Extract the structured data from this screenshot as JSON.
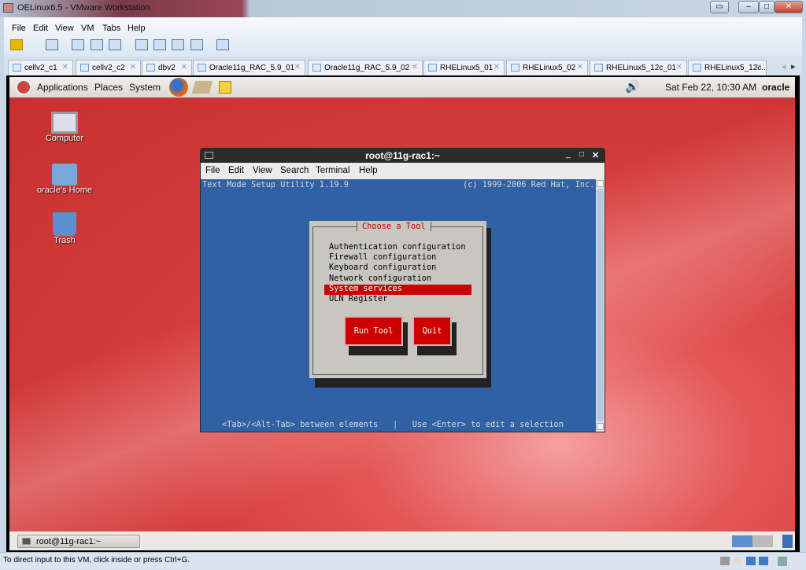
{
  "window": {
    "title": "OELinux6.5 - VMware Workstation"
  },
  "menu": [
    "File",
    "Edit",
    "View",
    "VM",
    "Tabs",
    "Help"
  ],
  "tabs": [
    "cellv2_c1",
    "cellv2_c2",
    "dbv2",
    "Oracle11g_RAC_5.9_01",
    "Oracle11g_RAC_5.9_02",
    "RHELinux5_01",
    "RHELinux5_02",
    "RHELinux5_12c_01",
    "RHELinux5_12c..."
  ],
  "panel": {
    "applications": "Applications",
    "places": "Places",
    "system": "System",
    "clock": "Sat Feb 22, 10:30 AM",
    "user": "oracle"
  },
  "desktop": {
    "icons": [
      "Computer",
      "oracle's Home",
      "Trash"
    ]
  },
  "terminal": {
    "title": "root@11g-rac1:~",
    "menu": [
      "File",
      "Edit",
      "View",
      "Search",
      "Terminal",
      "Help"
    ],
    "header_left": "Text Mode Setup Utility 1.19.9",
    "header_right": "(c) 1999-2006 Red Hat, Inc.",
    "dialog_title": "Choose a Tool",
    "items": [
      "Authentication configuration",
      "Firewall configuration",
      "Keyboard configuration",
      "Network configuration",
      "System services",
      "ULN Register"
    ],
    "selected_index": 4,
    "run_tool": "Run Tool",
    "quit": "Quit",
    "footer": "<Tab>/<Alt-Tab> between elements   |   Use <Enter> to edit a selection"
  },
  "taskbar": {
    "item": "root@11g-rac1:~"
  },
  "status": "To direct input to this VM, click inside or press Ctrl+G."
}
